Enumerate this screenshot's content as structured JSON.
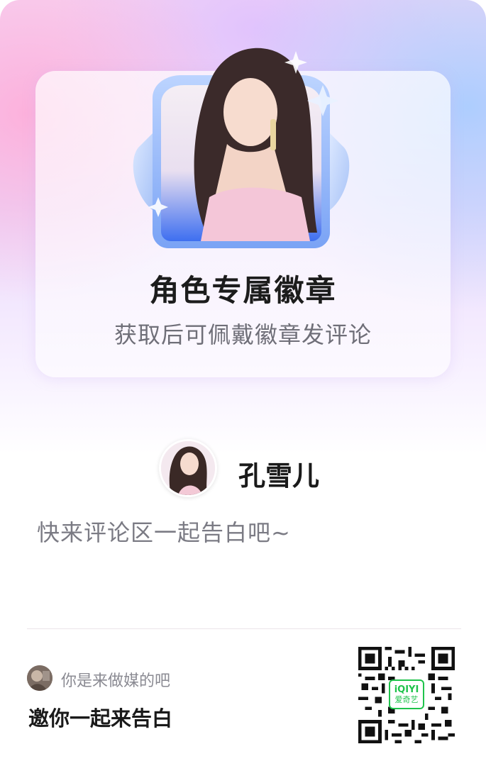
{
  "badge": {
    "title": "角色专属徽章",
    "subtitle": "获取后可佩戴徽章发评论"
  },
  "character": {
    "name": "孔雪儿",
    "invite_text": "快来评论区一起告白吧~"
  },
  "footer": {
    "caption": "你是来做媒的吧",
    "main_text": "邀你一起来告白",
    "qr_logo_brand": "iQIYI",
    "qr_logo_name": "爱奇艺"
  },
  "colors": {
    "badge_frame": "#4f7ff0",
    "qr_logo_green": "#1fc34b"
  }
}
